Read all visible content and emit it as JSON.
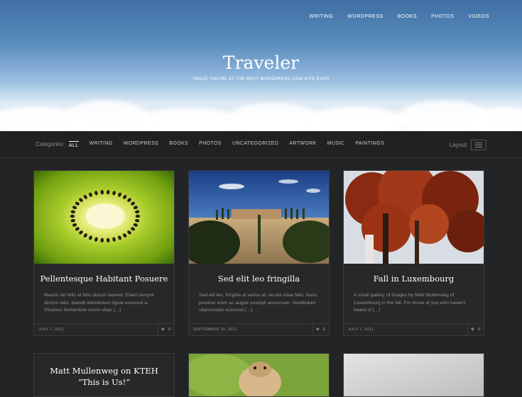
{
  "nav": [
    "WRITING",
    "WORDPRESS",
    "BOOKS",
    "PHOTOS",
    "VIDEOS"
  ],
  "site": {
    "title": "Traveler",
    "tagline": "SMILE! YOU'RE AT THE BEST WORDPRESS.COM SITE EVER"
  },
  "categories": {
    "label": "Categories:",
    "items": [
      "ALL",
      "WRITING",
      "WORDPRESS",
      "BOOKS",
      "PHOTOS",
      "UNCATEGORIZED",
      "ARTWORK",
      "MUSIC",
      "PAINTINGS"
    ],
    "active": "ALL"
  },
  "layout": {
    "label": "Layout:"
  },
  "posts": [
    {
      "title": "Pellentesque Habitant Posuere",
      "excerpt": "Mauris vel felis at felis dictum laoreet. Etiam tempor dictum odio, blandit elementum ligula euismod a. Vivamus fermentum lorem vitae […]",
      "date": "JULY 7, 2011",
      "likes": "0"
    },
    {
      "title": "Sed elit leo fringilla",
      "excerpt": "Sed elit leo, fringilla at varius at, iaculis vitae felis. Nunc pulvinar enim ac augue suscipit accumsan. Vestibulum ullamcorper euismod […]",
      "date": "SEPTEMBER 20, 2011",
      "likes": "0"
    },
    {
      "title": "Fall in Luxembourg",
      "excerpt": "A small gallery of images by Matt Mullenweg of Luxembourg in the fall. For those of you who haven't heard of […]",
      "date": "JULY 7, 2011",
      "likes": "0"
    },
    {
      "title": "Matt Mullenweg on KTEH “This is Us!”"
    }
  ],
  "colors": {
    "accent": "#ffffff",
    "background": "#222426"
  }
}
